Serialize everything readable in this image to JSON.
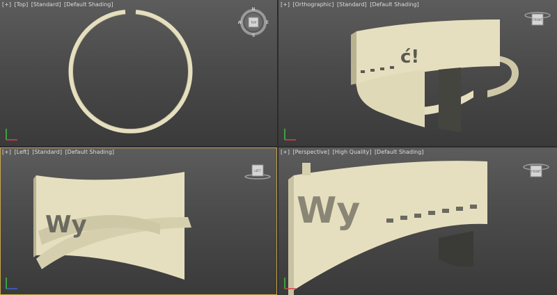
{
  "viewports": {
    "top": {
      "labels": [
        "[+]",
        "[Top]",
        "[Standard]",
        "[Default Shading]"
      ]
    },
    "ortho": {
      "labels": [
        "[+]",
        "[Orthographic]",
        "[Standard]",
        "[Default Shading]"
      ]
    },
    "left": {
      "labels": [
        "[+]",
        "[Left]",
        "[Standard]",
        "[Default Shading]"
      ]
    },
    "persp": {
      "labels": [
        "[+]",
        "[Perspective]",
        "[High Quality]",
        "[Default Shading]"
      ]
    }
  },
  "compass": {
    "n": "N",
    "s": "S",
    "e": "E",
    "w": "W",
    "cube_face": "TOP"
  },
  "cube_faces": {
    "ortho": "FRONT",
    "left": "LEFT",
    "persp": "FRONT"
  },
  "model_text": {
    "ortho": "ć!",
    "left": "Wy",
    "persp": "Wy"
  },
  "colors": {
    "model": "#e6dfbf",
    "model_shadow": "#b9b291",
    "active_border": "#c8a84a",
    "label": "#dcdcdc"
  }
}
